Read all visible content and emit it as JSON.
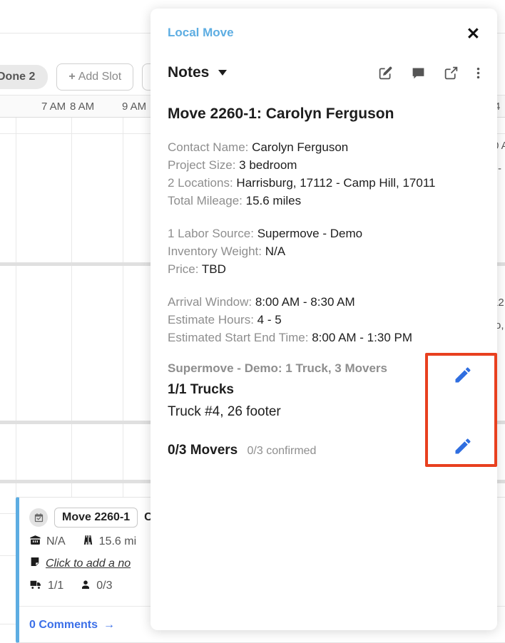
{
  "background": {
    "toolbar": {
      "done_badge": "Done 2",
      "add_slot_label": "Add Slot",
      "add_slot_plus": "+"
    },
    "time_header": {
      "labels": [
        "7 AM",
        "8 AM",
        "9 AM",
        "4"
      ]
    },
    "snippets": {
      "s1": "0 A",
      "s2": "-",
      "s3": "12",
      "s4": "o,"
    },
    "event_card": {
      "calendar_icon": "calendar-check-icon",
      "move_id": "Move 2260-1",
      "customer_initial": "C",
      "weight_icon": "box-weight-icon",
      "weight": "N/A",
      "road_icon": "road-icon",
      "mileage": "15.6 mi",
      "note_icon": "note-icon",
      "note_placeholder": "Click to add a no",
      "truck_icon": "truck-icon",
      "trucks": "1/1",
      "person_icon": "person-icon",
      "movers": "0/3",
      "comments_label": "0 Comments",
      "comments_arrow": "→"
    }
  },
  "modal": {
    "kicker": "Local Move",
    "close_label": "✕",
    "section_label": "Notes",
    "head_icons": [
      {
        "name": "edit-square-icon"
      },
      {
        "name": "comment-bubble-icon"
      },
      {
        "name": "external-link-icon"
      },
      {
        "name": "more-vertical-icon"
      }
    ],
    "title": "Move 2260-1: Carolyn Ferguson",
    "details_group_1": [
      {
        "key": "Contact Name:",
        "value": "Carolyn Ferguson"
      },
      {
        "key": "Project Size:",
        "value": "3 bedroom"
      },
      {
        "key": "2 Locations:",
        "value": "Harrisburg, 17112 - Camp Hill, 17011"
      },
      {
        "key": "Total Mileage:",
        "value": "15.6 miles"
      }
    ],
    "details_group_2": [
      {
        "key": "1 Labor Source:",
        "value": "Supermove - Demo"
      },
      {
        "key": "Inventory Weight:",
        "value": "N/A"
      },
      {
        "key": "Price:",
        "value": "TBD"
      }
    ],
    "details_group_3": [
      {
        "key": "Arrival Window:",
        "value": "8:00 AM - 8:30 AM"
      },
      {
        "key": "Estimate Hours:",
        "value": "4 - 5"
      },
      {
        "key": "Estimated Start End Time:",
        "value": "8:00 AM - 1:30 PM"
      }
    ],
    "crew": {
      "heading": "Supermove - Demo: 1 Truck, 3 Movers",
      "trucks_count": "1/1 Trucks",
      "truck_detail": "Truck #4, 26 footer",
      "movers_count": "0/3 Movers",
      "movers_confirmed": "0/3 confirmed",
      "edit_truck_icon": "pencil-icon",
      "edit_movers_icon": "pencil-icon"
    }
  },
  "annotation": {
    "name": "red-highlight-box",
    "color": "#e8401f"
  },
  "colors": {
    "accent_blue": "#5dade2",
    "link_blue": "#3b6fe8",
    "pencil_blue": "#2f6ee0",
    "annotation_red": "#e8401f",
    "muted_gray": "#8e8e8e"
  }
}
